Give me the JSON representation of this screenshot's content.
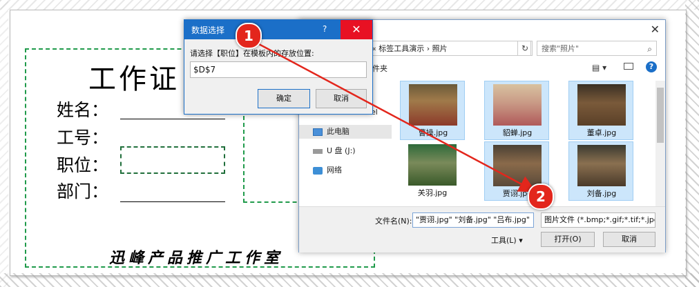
{
  "card": {
    "title": "工作证",
    "labels": [
      "姓名：",
      "工号：",
      "职位：",
      "部门："
    ],
    "footer": "迅峰产品推广工作室"
  },
  "file_dialog": {
    "close": "✕",
    "address_path": "«  标签工具演示  ›  照片",
    "refresh": "↻",
    "search_placeholder": "搜索\"照片\"",
    "toolbar_partial": "件夹",
    "nav": [
      {
        "label": "el",
        "icon": "folder-icon"
      },
      {
        "label": "此电脑",
        "icon": "computer-icon"
      },
      {
        "label": "U 盘 (J:)",
        "icon": "drive-icon"
      },
      {
        "label": "网络",
        "icon": "network-icon"
      }
    ],
    "thumbnails": [
      {
        "caption": "曹操.jpg",
        "selected": true
      },
      {
        "caption": "貂蝉.jpg",
        "selected": true
      },
      {
        "caption": "董卓.jpg",
        "selected": true
      },
      {
        "caption": "关羽.jpg",
        "selected": false
      },
      {
        "caption": "贾诩.jpg",
        "selected": true
      },
      {
        "caption": "刘备.jpg",
        "selected": true
      }
    ],
    "filename_label": "文件名(N):",
    "filename_value": "\"贾诩.jpg\" \"刘备.jpg\" \"吕布.jpg\"",
    "filetype_value": "图片文件 (*.bmp;*.gif;*.tif;*.jpg",
    "tools_label": "工具(L)",
    "open_label": "打开(O)",
    "cancel_label": "取消"
  },
  "data_dialog": {
    "title": "数据选择",
    "help": "?",
    "close": "✕",
    "prompt": "请选择【职位】在模板内的存放位置:",
    "input_value": "$D$7",
    "ok_label": "确定",
    "cancel_label": "取消"
  },
  "callouts": [
    "1",
    "2"
  ],
  "colors": {
    "accent_blue": "#1b6fc8",
    "card_green": "#1f9a4a",
    "callout_red": "#e3261c"
  }
}
